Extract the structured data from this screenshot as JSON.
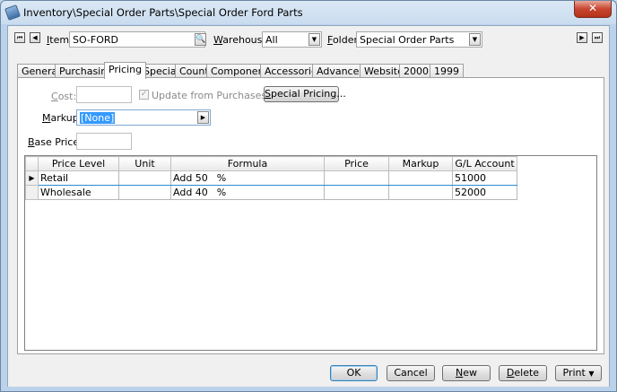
{
  "window": {
    "title": "Inventory\\Special Order Parts\\Special Order Ford Parts",
    "close_symbol": "✕"
  },
  "header": {
    "item_label": "Item:",
    "item_value": "SO-FORD",
    "warehouse_label": "Warehouse:",
    "warehouse_value": "All",
    "folder_label": "Folder:",
    "folder_value": "Special Order Parts"
  },
  "tabs": [
    "General",
    "Purchasing",
    "Pricing",
    "Special",
    "Count",
    "Components",
    "Accessories",
    "Advanced",
    "Website",
    "2000",
    "1999"
  ],
  "active_tab": "Pricing",
  "pricing": {
    "cost_label": "Cost:",
    "cost_value": "",
    "update_label": "Update from Purchases",
    "update_checked": true,
    "special_pricing_label": "Special Pricing...",
    "markup_label": "Markup:",
    "markup_value": "[None]",
    "base_price_label": "Base Price:",
    "base_price_value": ""
  },
  "grid": {
    "columns": [
      "Price Level",
      "Unit",
      "Formula",
      "Price",
      "Markup",
      "G/L Account"
    ],
    "rows": [
      {
        "price_level": "Retail",
        "unit": "",
        "formula_prefix": "Add 50",
        "formula_unit": "%",
        "price": "",
        "markup": "",
        "gl_account": "51000",
        "current": true
      },
      {
        "price_level": "Wholesale",
        "unit": "",
        "formula_prefix": "Add 40",
        "formula_unit": "%",
        "price": "",
        "markup": "",
        "gl_account": "52000",
        "current": false
      }
    ]
  },
  "buttons": {
    "ok": "OK",
    "cancel": "Cancel",
    "new": "New",
    "delete": "Delete",
    "print": "Print"
  }
}
